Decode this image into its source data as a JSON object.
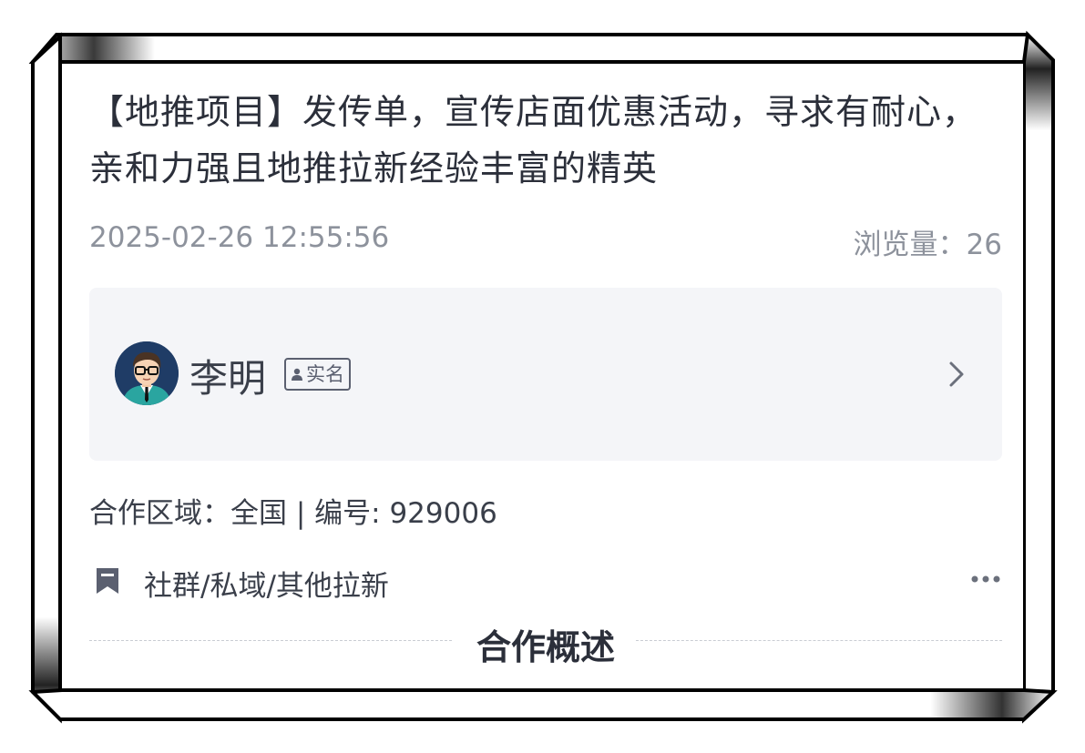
{
  "post": {
    "title": "【地推项目】发传单，宣传店面优惠活动，寻求有耐心，亲和力强且地推拉新经验丰富的精英",
    "timestamp": "2025-02-26 12:55:56",
    "views_label": "浏览量：26"
  },
  "author": {
    "name": "李明",
    "verified_label": "实名",
    "avatar_icon": "avatar-glasses-man",
    "chevron_icon": "chevron-right-icon"
  },
  "details": {
    "info_line": "合作区域：全国 | 编号: 929006",
    "category": "社群/私域/其他拉新",
    "category_icon": "bookmark-icon",
    "more_icon": "more-horizontal-icon"
  },
  "section": {
    "title": "合作概述"
  },
  "colors": {
    "text_primary": "#2b2f3a",
    "text_secondary": "#8d929c",
    "panel_bg": "#f4f5f8",
    "icon_gray": "#5b6070"
  }
}
